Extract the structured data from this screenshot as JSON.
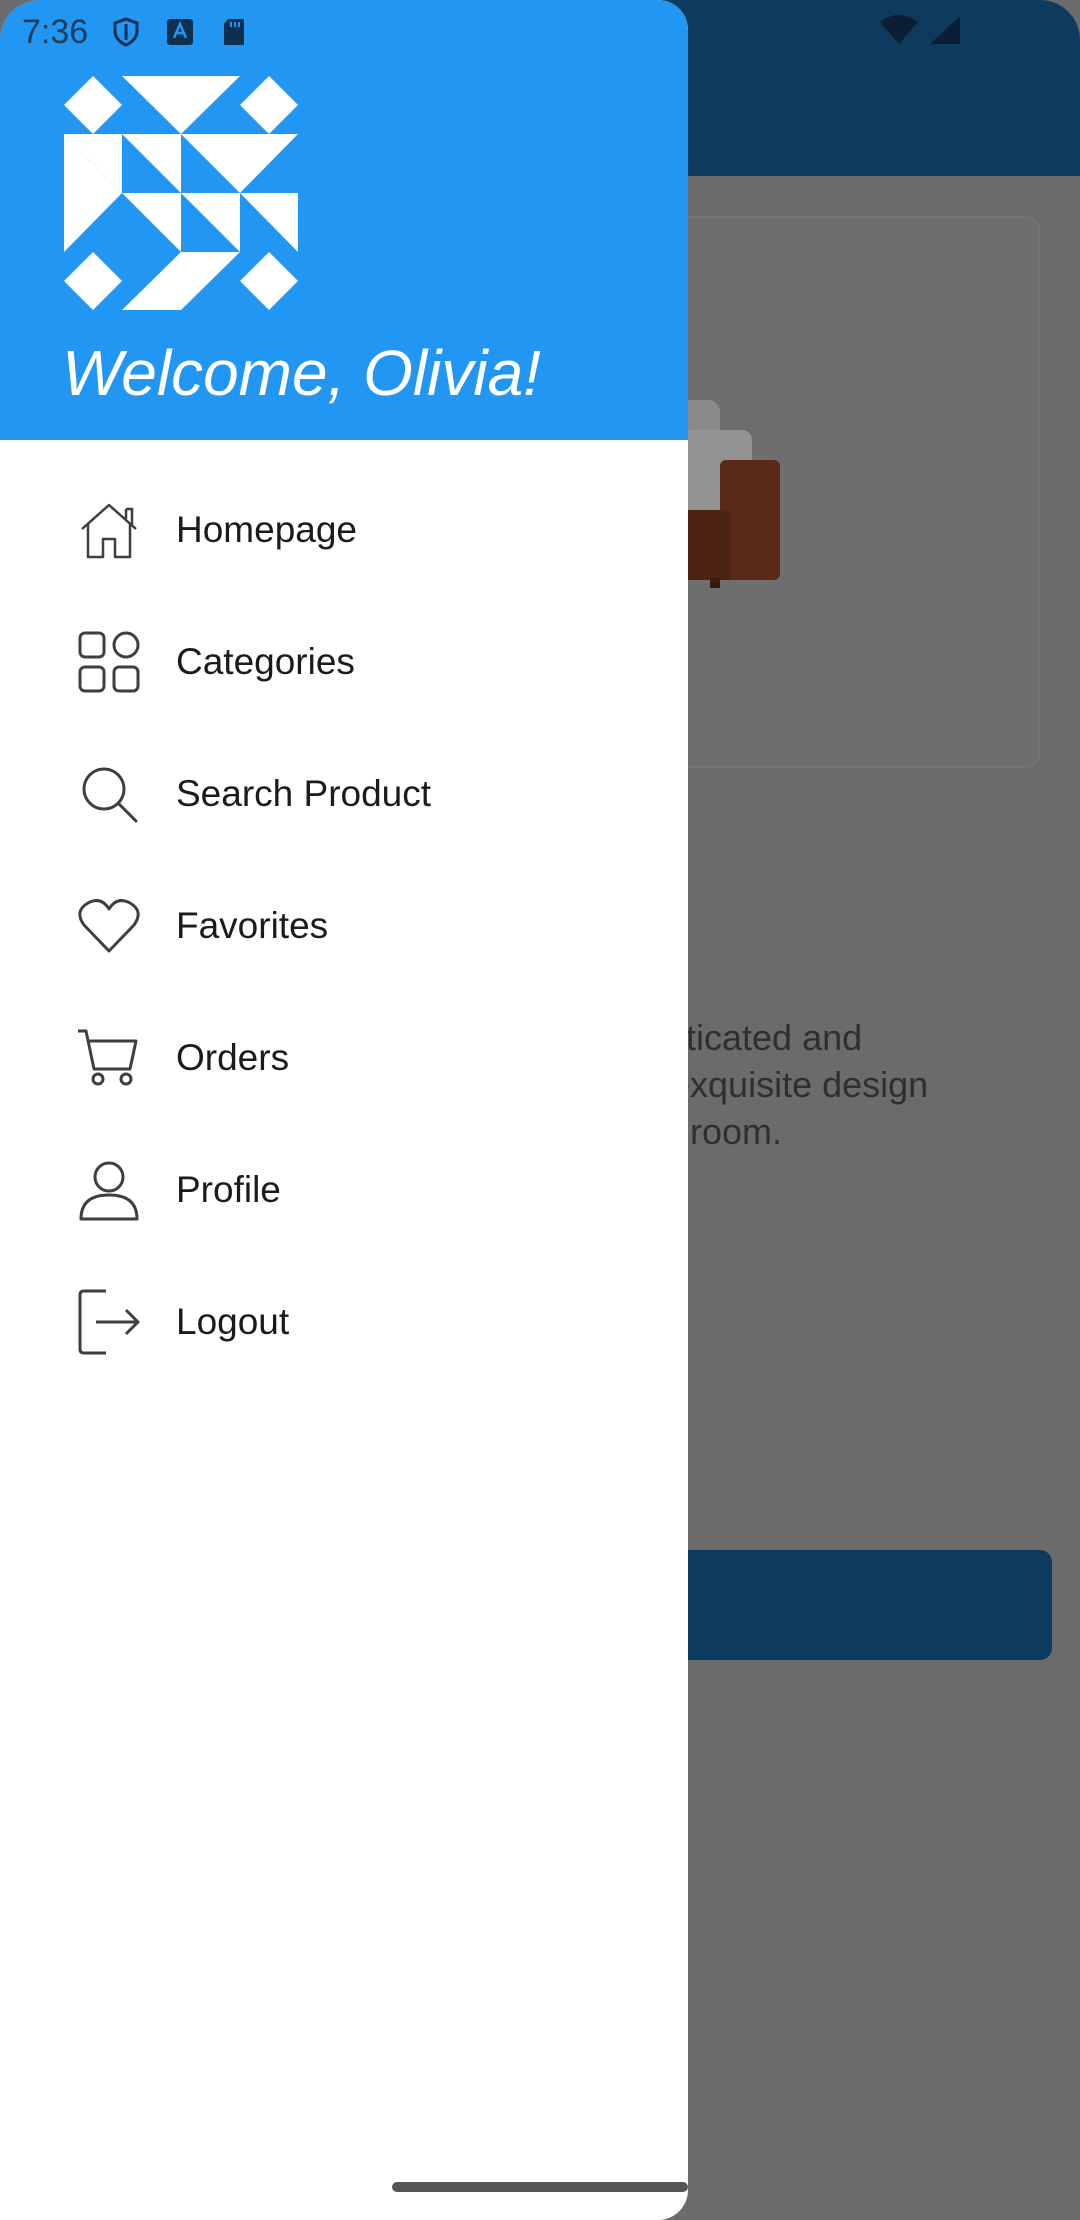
{
  "status_bar": {
    "time": "7:36",
    "icons": [
      "shield-icon",
      "a-accessibility-icon",
      "sd-card-icon",
      "wifi-icon",
      "signal-icon"
    ]
  },
  "drawer": {
    "welcome_text": "Welcome, Olivia!",
    "logo": "quilt-pattern-logo",
    "header_color": "#2196f3",
    "items": [
      {
        "label": "Homepage",
        "icon": "home-icon"
      },
      {
        "label": "Categories",
        "icon": "categories-grid-icon"
      },
      {
        "label": "Search Product",
        "icon": "search-icon"
      },
      {
        "label": "Favorites",
        "icon": "heart-icon"
      },
      {
        "label": "Orders",
        "icon": "cart-icon"
      },
      {
        "label": "Profile",
        "icon": "person-icon"
      },
      {
        "label": "Logout",
        "icon": "logout-icon"
      }
    ]
  },
  "background": {
    "appbar_color": "#0e3a5e",
    "description_visible": "isticated and\n exquisite design\ng room."
  }
}
